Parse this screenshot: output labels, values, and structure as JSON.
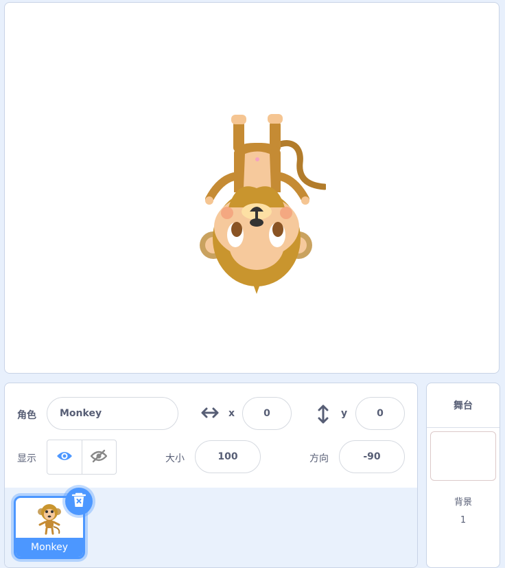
{
  "sprite_info": {
    "sprite_label": "角色",
    "sprite_name": "Monkey",
    "x_label": "x",
    "x_value": "0",
    "y_label": "y",
    "y_value": "0",
    "show_label": "显示",
    "size_label": "大小",
    "size_value": "100",
    "direction_label": "方向",
    "direction_value": "-90"
  },
  "sprites": [
    {
      "name": "Monkey",
      "selected": true
    }
  ],
  "stage_panel": {
    "title": "舞台",
    "backdrop_label": "背景",
    "backdrop_count": "1"
  },
  "colors": {
    "accent": "#4c97ff",
    "text": "#575e75"
  }
}
